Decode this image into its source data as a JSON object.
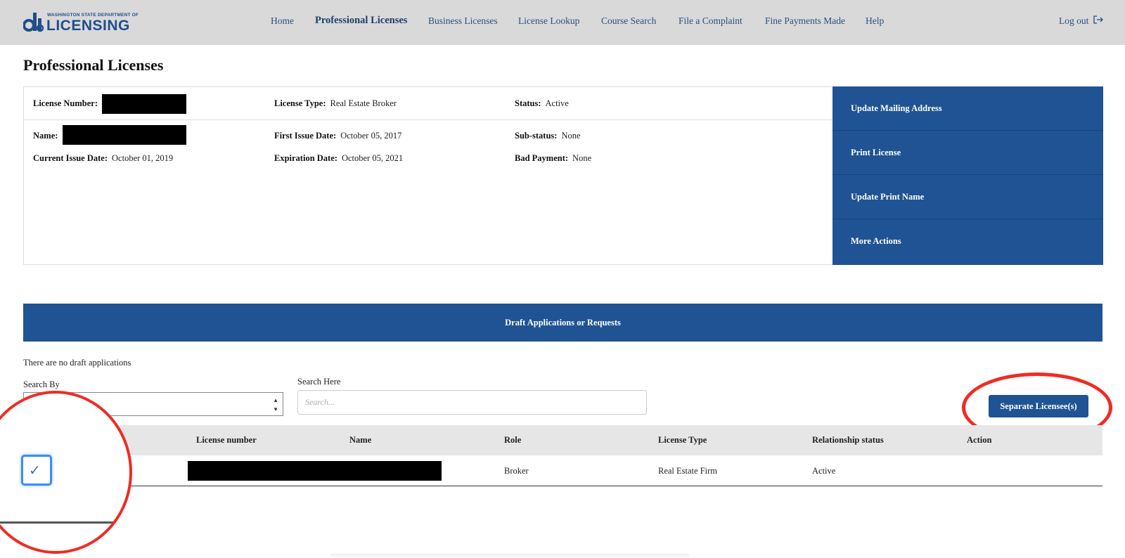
{
  "header": {
    "logo_small": "WASHINGTON STATE DEPARTMENT OF",
    "logo_big": "LICENSING",
    "nav": [
      {
        "label": "Home"
      },
      {
        "label": "Professional Licenses"
      },
      {
        "label": "Business Licenses"
      },
      {
        "label": "License Lookup"
      },
      {
        "label": "Course Search"
      },
      {
        "label": "File a Complaint"
      },
      {
        "label": "Fine Payments Made"
      },
      {
        "label": "Help"
      }
    ],
    "logout_label": "Log out",
    "logout_icon": "logout-icon"
  },
  "page_title": "Professional Licenses",
  "license": {
    "number_label": "License Number:",
    "type_label": "License Type:",
    "type_value": "Real Estate Broker",
    "status_label": "Status:",
    "status_value": "Active",
    "name_label": "Name:",
    "first_issue_label": "First Issue Date:",
    "first_issue_value": "October 05, 2017",
    "substatus_label": "Sub-status:",
    "substatus_value": "None",
    "current_issue_label": "Current Issue Date:",
    "current_issue_value": "October 01, 2019",
    "expiration_label": "Expiration Date:",
    "expiration_value": "October 05, 2021",
    "bad_payment_label": "Bad Payment:",
    "bad_payment_value": "None"
  },
  "actions": [
    {
      "label": "Update Mailing Address"
    },
    {
      "label": "Print License"
    },
    {
      "label": "Update Print Name"
    },
    {
      "label": "More Actions"
    }
  ],
  "drafts": {
    "title": "Draft Applications or Requests",
    "empty_text": "There are no draft applications"
  },
  "search": {
    "by_label": "Search By",
    "here_label": "Search Here",
    "placeholder": "Search..."
  },
  "separate_button": "Separate Licensee(s)",
  "table": {
    "headers": [
      "License number",
      "Name",
      "Role",
      "License Type",
      "Relationship status",
      "Action"
    ],
    "rows": [
      {
        "role": "Broker",
        "license_type": "Real Estate Firm",
        "relationship_status": "Active"
      }
    ]
  },
  "colors": {
    "brand_blue": "#1f5394",
    "annotation_red": "#ee2d24",
    "checkbox_focus": "#3b8cf5"
  }
}
